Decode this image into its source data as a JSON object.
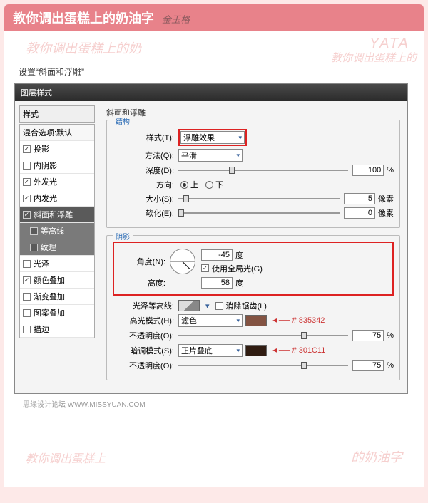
{
  "page": {
    "title": "教你调出蛋糕上的奶油字",
    "author": "金玉格",
    "caption": "设置“斜面和浮雕”",
    "footer": "思缘设计论坛  WWW.MISSYUAN.COM"
  },
  "watermarks": {
    "wm1": "教你调出蛋糕上的奶",
    "yata": "YATA",
    "wm2": "教你调出蛋糕上的",
    "wm3": "教你调出蛋糕上",
    "wm4": "的奶油字"
  },
  "dialog": {
    "title": "图层样式",
    "left": {
      "header": "样式",
      "blend": "混合选项:默认",
      "items": [
        {
          "label": "投影",
          "checked": true
        },
        {
          "label": "内阴影",
          "checked": false
        },
        {
          "label": "外发光",
          "checked": true
        },
        {
          "label": "内发光",
          "checked": true
        },
        {
          "label": "斜面和浮雕",
          "checked": true,
          "selected": true
        },
        {
          "label": "等高线",
          "checked": false,
          "sub": true
        },
        {
          "label": "纹理",
          "checked": false,
          "sub": true
        },
        {
          "label": "光泽",
          "checked": false
        },
        {
          "label": "颜色叠加",
          "checked": true
        },
        {
          "label": "渐变叠加",
          "checked": false
        },
        {
          "label": "图案叠加",
          "checked": false
        },
        {
          "label": "描边",
          "checked": false
        }
      ]
    },
    "bevel": {
      "title": "斜面和浮雕",
      "structure_legend": "结构",
      "style_label": "样式(T):",
      "style_value": "浮雕效果",
      "technique_label": "方法(Q):",
      "technique_value": "平滑",
      "depth_label": "深度(D):",
      "depth_value": "100",
      "depth_unit": "%",
      "direction_label": "方向:",
      "direction_up": "上",
      "direction_down": "下",
      "size_label": "大小(S):",
      "size_value": "5",
      "size_unit": "像素",
      "soften_label": "软化(E):",
      "soften_value": "0",
      "soften_unit": "像素"
    },
    "shading": {
      "legend": "阴影",
      "angle_label": "角度(N):",
      "angle_value": "-45",
      "angle_unit": "度",
      "global_light": "使用全局光(G)",
      "altitude_label": "高度:",
      "altitude_value": "58",
      "altitude_unit": "度",
      "gloss_label": "光泽等高线:",
      "antialias": "消除锯齿(L)",
      "highlight_mode_label": "高光模式(H):",
      "highlight_mode_value": "滤色",
      "highlight_color": "#835342",
      "highlight_note": "# 835342",
      "highlight_opacity_label": "不透明度(O):",
      "highlight_opacity_value": "75",
      "highlight_opacity_unit": "%",
      "shadow_mode_label": "暗调模式(S):",
      "shadow_mode_value": "正片叠底",
      "shadow_color": "#301C11",
      "shadow_note": "# 301C11",
      "shadow_opacity_label": "不透明度(O):",
      "shadow_opacity_value": "75",
      "shadow_opacity_unit": "%"
    }
  }
}
